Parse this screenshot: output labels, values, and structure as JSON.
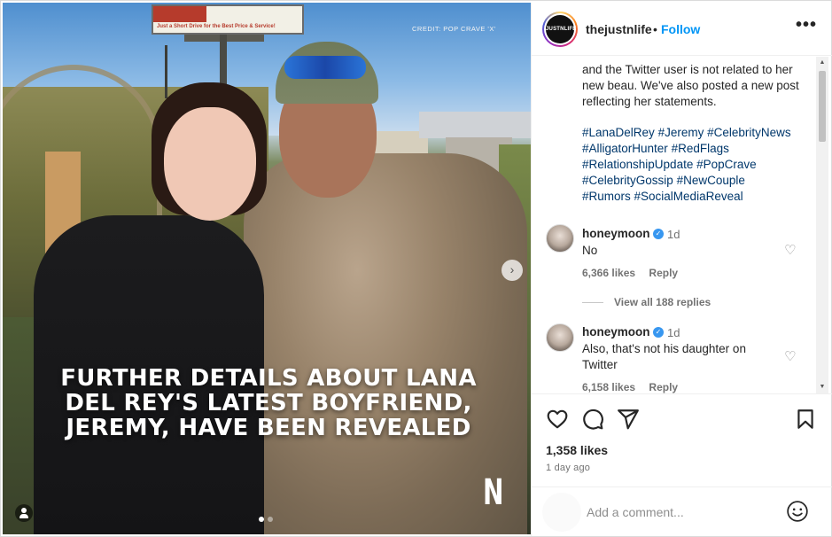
{
  "media": {
    "credit": "CREDIT: POP CRAVE 'X'",
    "headline_lines": [
      "FURTHER DETAILS ABOUT LANA",
      "DEL REY'S LATEST BOYFRIEND,",
      "JEREMY, HAVE BEEN REVEALED"
    ],
    "billboard_text": "Just a Short Drive for the Best Price & Service!",
    "logo_letter": "N",
    "next_glyph": "›",
    "carousel": {
      "current": 1,
      "total": 2
    }
  },
  "post": {
    "author": "thejustnlife",
    "avatar_text": "JUSTNLIFE",
    "separator": "•",
    "follow_label": "Follow",
    "more_glyph": "•••",
    "caption": "and the Twitter user is not related to her new beau. We've also posted a new post reflecting her statements.",
    "hashtags": [
      "#LanaDelRey",
      "#Jeremy",
      "#CelebrityNews",
      "#AlligatorHunter",
      "#RedFlags",
      "#RelationshipUpdate",
      "#PopCrave",
      "#CelebrityGossip",
      "#NewCouple",
      "#Rumors",
      "#SocialMediaReveal"
    ]
  },
  "comments": [
    {
      "user": "honeymoon",
      "verified": true,
      "time": "1d",
      "text": "No",
      "likes": "6,366 likes",
      "reply_label": "Reply",
      "view_replies": "View all 188 replies"
    },
    {
      "user": "honeymoon",
      "verified": true,
      "time": "1d",
      "text": "Also, that's not his daughter on Twitter",
      "likes": "6,158 likes",
      "reply_label": "Reply"
    }
  ],
  "actions": {
    "likes": "1,358 likes",
    "time_ago": "1 day ago",
    "icons": [
      "heart-icon",
      "comment-icon",
      "share-icon",
      "bookmark-icon"
    ]
  },
  "comment_box": {
    "placeholder": "Add a comment..."
  },
  "colors": {
    "link": "#0095f6",
    "hashtag": "#00376b",
    "muted": "#737373",
    "text": "#262626"
  }
}
